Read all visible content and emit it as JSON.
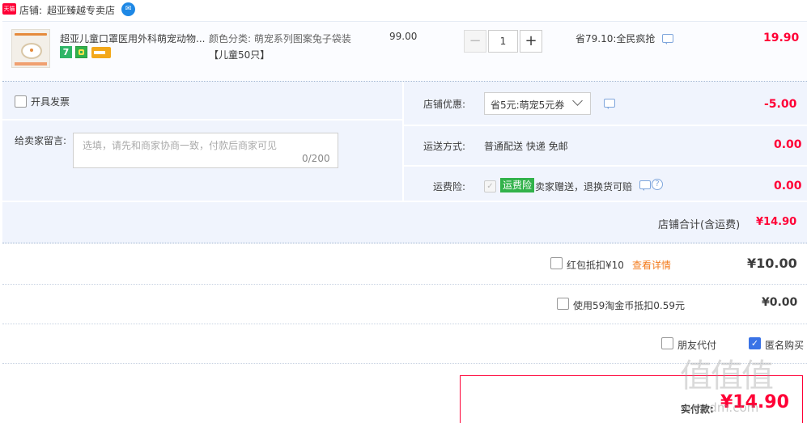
{
  "shop": {
    "badge": "天猫",
    "prefix": "店铺:",
    "name": "超亚臻越专卖店",
    "ww_icon": "chat-bubble-icon"
  },
  "product": {
    "title": "超亚儿童口罩医用外科萌宠动物...",
    "icon_7": "7",
    "sku_line1": "颜色分类: 萌宠系列图案兔子袋装",
    "sku_line2": "【儿童50只】",
    "unit_price": "99.00",
    "quantity": "1",
    "qty_minus": "−",
    "qty_plus": "+",
    "promo": "省79.10:全民疯抢",
    "subtotal": "19.90"
  },
  "options": {
    "invoice_label": "开具发票",
    "message_label": "给卖家留言:",
    "message_placeholder": "选填，请先和商家协商一致，付款后商家可见",
    "message_count": "0/200",
    "shop_discount_label": "店铺优惠:",
    "coupon_selected": "省5元:萌宠5元券",
    "shop_discount_value": "-5.00",
    "shipping_label": "运送方式:",
    "shipping_value": "普通配送 快递 免邮",
    "shipping_price": "0.00",
    "insurance_label": "运费险:",
    "insurance_badge": "运费险",
    "insurance_text": "卖家赠送，退换货可赔",
    "insurance_help": "?",
    "insurance_price": "0.00",
    "shop_total_label": "店铺合计(含运费)",
    "shop_total_value": "¥14.90"
  },
  "redpacket": {
    "label": "红包抵扣¥10",
    "link": "查看详情",
    "value": "¥10.00"
  },
  "coins": {
    "label": "使用59淘金币抵扣0.59元",
    "value": "¥0.00"
  },
  "pay_options": {
    "friend_label": "朋友代付",
    "anonymous_label": "匿名购买"
  },
  "payment": {
    "label": "实付款:",
    "value": "¥14.90"
  },
  "watermark": {
    "text": "值值值",
    "url": "smzdm.com"
  },
  "colors": {
    "accent_red": "#ff0036",
    "panel_blue": "#f0f4fd",
    "checkbox_blue": "#3a73e6",
    "badge_green": "#31b24a",
    "link_orange": "#f37b1d"
  }
}
